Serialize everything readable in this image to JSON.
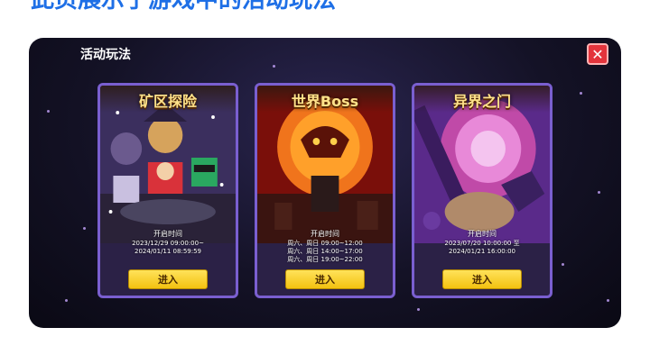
{
  "caption": "此页展示了游戏中的活动玩法",
  "header": {
    "title": "活动玩法",
    "close_icon": "close-icon"
  },
  "cards": [
    {
      "title": "矿区探险",
      "open_label": "开启时间",
      "lines": [
        "2023/12/29 09:00:00~",
        "2024/01/11 08:59:59"
      ],
      "button": "进入"
    },
    {
      "title": "世界Boss",
      "open_label": "开启时间",
      "lines": [
        "周六、周日 09:00~12:00",
        "周六、周日 14:00~17:00",
        "周六、周日 19:00~22:00"
      ],
      "button": "进入"
    },
    {
      "title": "异界之门",
      "open_label": "开启时间",
      "lines": [
        "2023/07/20 10:00:00 至",
        "2024/01/21 16:00:00"
      ],
      "button": "进入"
    }
  ],
  "colors": {
    "accent": "#f3c210",
    "close": "#e3343c",
    "frame": "#7a5fd0"
  }
}
